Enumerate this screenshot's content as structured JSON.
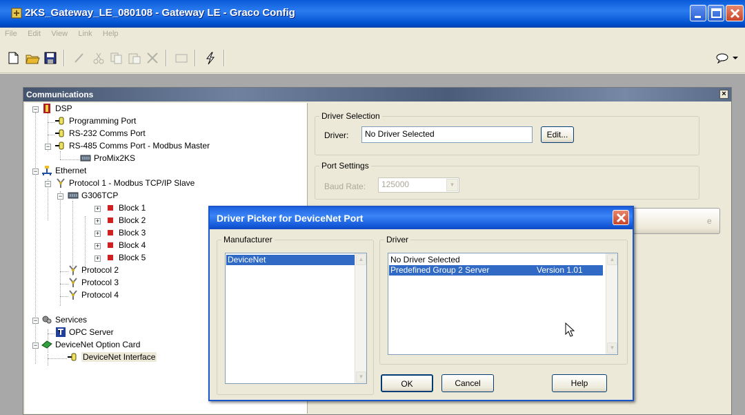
{
  "window": {
    "title": "2KS_Gateway_LE_080108 - Gateway LE - Graco Config"
  },
  "menu": [
    "File",
    "Edit",
    "View",
    "Link",
    "Help"
  ],
  "toolbar": {
    "icons": [
      "new-icon",
      "open-icon",
      "save-icon",
      "pen-icon",
      "cut-icon",
      "copy-icon",
      "paste-icon",
      "delete-icon",
      "window-icon",
      "lightning-icon",
      "help-balloon-icon"
    ]
  },
  "panel": {
    "title": "Communications",
    "close": "×"
  },
  "tree": {
    "dsp": "DSP",
    "programming_port": "Programming Port",
    "rs232": "RS-232 Comms Port",
    "rs485": "RS-485 Comms Port - Modbus Master",
    "promix": "ProMix2KS",
    "ethernet": "Ethernet",
    "protocol1": "Protocol 1 - Modbus TCP/IP Slave",
    "g306": "G306TCP",
    "blocks": [
      "Block 1",
      "Block 2",
      "Block 3",
      "Block 4",
      "Block 5"
    ],
    "protocol2": "Protocol 2",
    "protocol3": "Protocol 3",
    "protocol4": "Protocol 4",
    "services": "Services",
    "opc": "OPC Server",
    "devicenet_card": "DeviceNet Option Card",
    "devicenet_iface": "DeviceNet Interface"
  },
  "driver_selection": {
    "group": "Driver Selection",
    "label": "Driver:",
    "value": "No Driver Selected",
    "edit_button": "Edit..."
  },
  "port_settings": {
    "group": "Port Settings",
    "baud_label": "Baud Rate:",
    "baud_value": "125000"
  },
  "dialog": {
    "title": "Driver Picker for DeviceNet Port",
    "manufacturer_label": "Manufacturer",
    "manufacturers": [
      "DeviceNet"
    ],
    "driver_label": "Driver",
    "drivers": [
      {
        "name": "No Driver Selected",
        "version": ""
      },
      {
        "name": "Predefined Group 2 Server",
        "version": "Version 1.01"
      }
    ],
    "ok": "OK",
    "cancel": "Cancel",
    "help": "Help",
    "partial_button_text": "e"
  }
}
